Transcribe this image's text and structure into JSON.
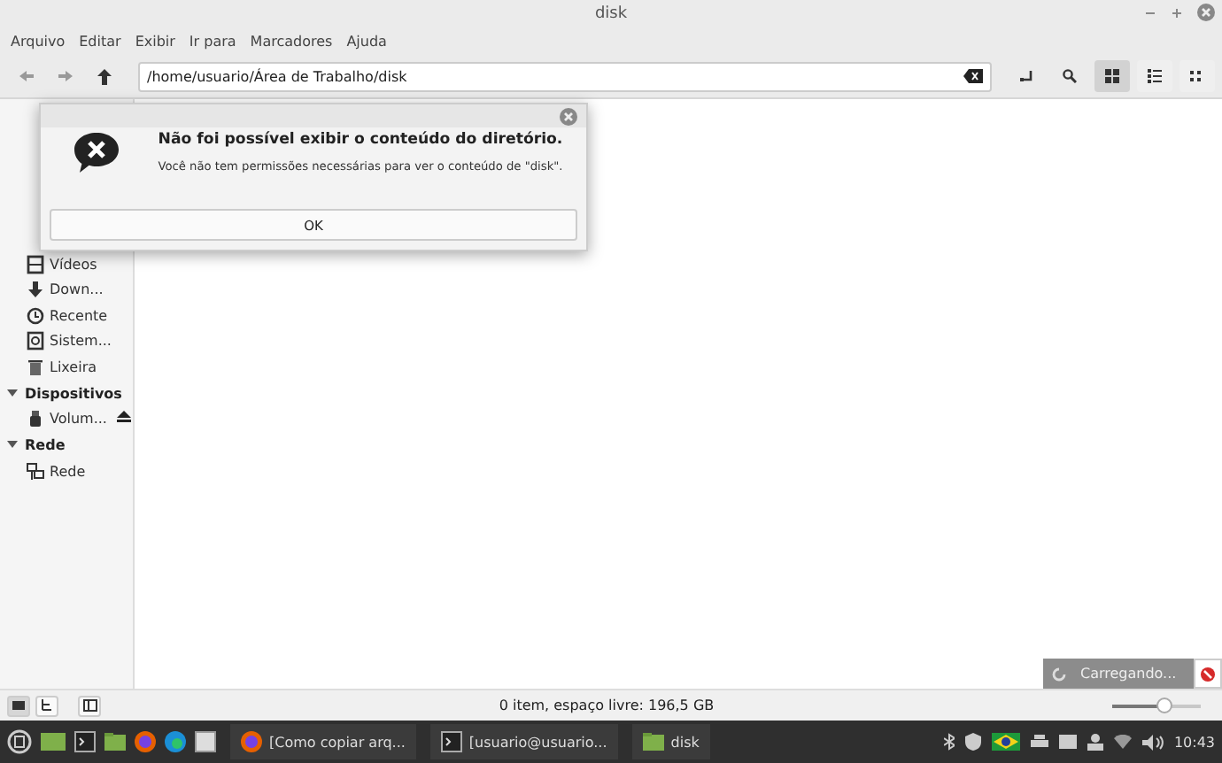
{
  "window": {
    "title": "disk"
  },
  "menu": [
    "Arquivo",
    "Editar",
    "Exibir",
    "Ir para",
    "Marcadores",
    "Ajuda"
  ],
  "location": {
    "value": "/home/usuario/Área de Trabalho/disk"
  },
  "view_modes": [
    {
      "kind": "icons",
      "selected": true
    },
    {
      "kind": "list",
      "selected": false
    },
    {
      "kind": "compact",
      "selected": false
    }
  ],
  "sidebar": {
    "sections": [
      {
        "items": [
          {
            "label": "Vídeos",
            "kind": "video"
          },
          {
            "label": "Down...",
            "kind": "download"
          },
          {
            "label": "Recente",
            "kind": "recent"
          },
          {
            "label": "Sistem...",
            "kind": "system"
          },
          {
            "label": "Lixeira",
            "kind": "trash"
          }
        ]
      },
      {
        "title": "Dispositivos",
        "expanded": true,
        "items": [
          {
            "label": "Volum...",
            "kind": "usb"
          }
        ]
      },
      {
        "title": "Rede",
        "expanded": true,
        "items": [
          {
            "label": "Rede",
            "kind": "network"
          }
        ]
      }
    ]
  },
  "dialog": {
    "title": "Não foi possível exibir o conteúdo do diretório.",
    "message": "Você não tem permissões necessárias para ver o conteúdo de \"disk\".",
    "button": "OK"
  },
  "loading": {
    "label": "Carregando..."
  },
  "status_bar": {
    "pane_buttons": [
      {
        "kind": "places",
        "selected": true
      },
      {
        "kind": "tree",
        "selected": false
      },
      {
        "kind": "hide",
        "selected": false
      }
    ],
    "text": "0 item, espaço livre: 196,5 GB",
    "zoom": {
      "level": 0.6
    }
  },
  "taskbar": {
    "windows": [
      {
        "label": "[Como copiar arq...",
        "kind": "browser"
      },
      {
        "label": "[usuario@usuario...",
        "kind": "terminal"
      },
      {
        "label": "disk",
        "kind": "folder"
      }
    ],
    "clock": "10:43"
  }
}
